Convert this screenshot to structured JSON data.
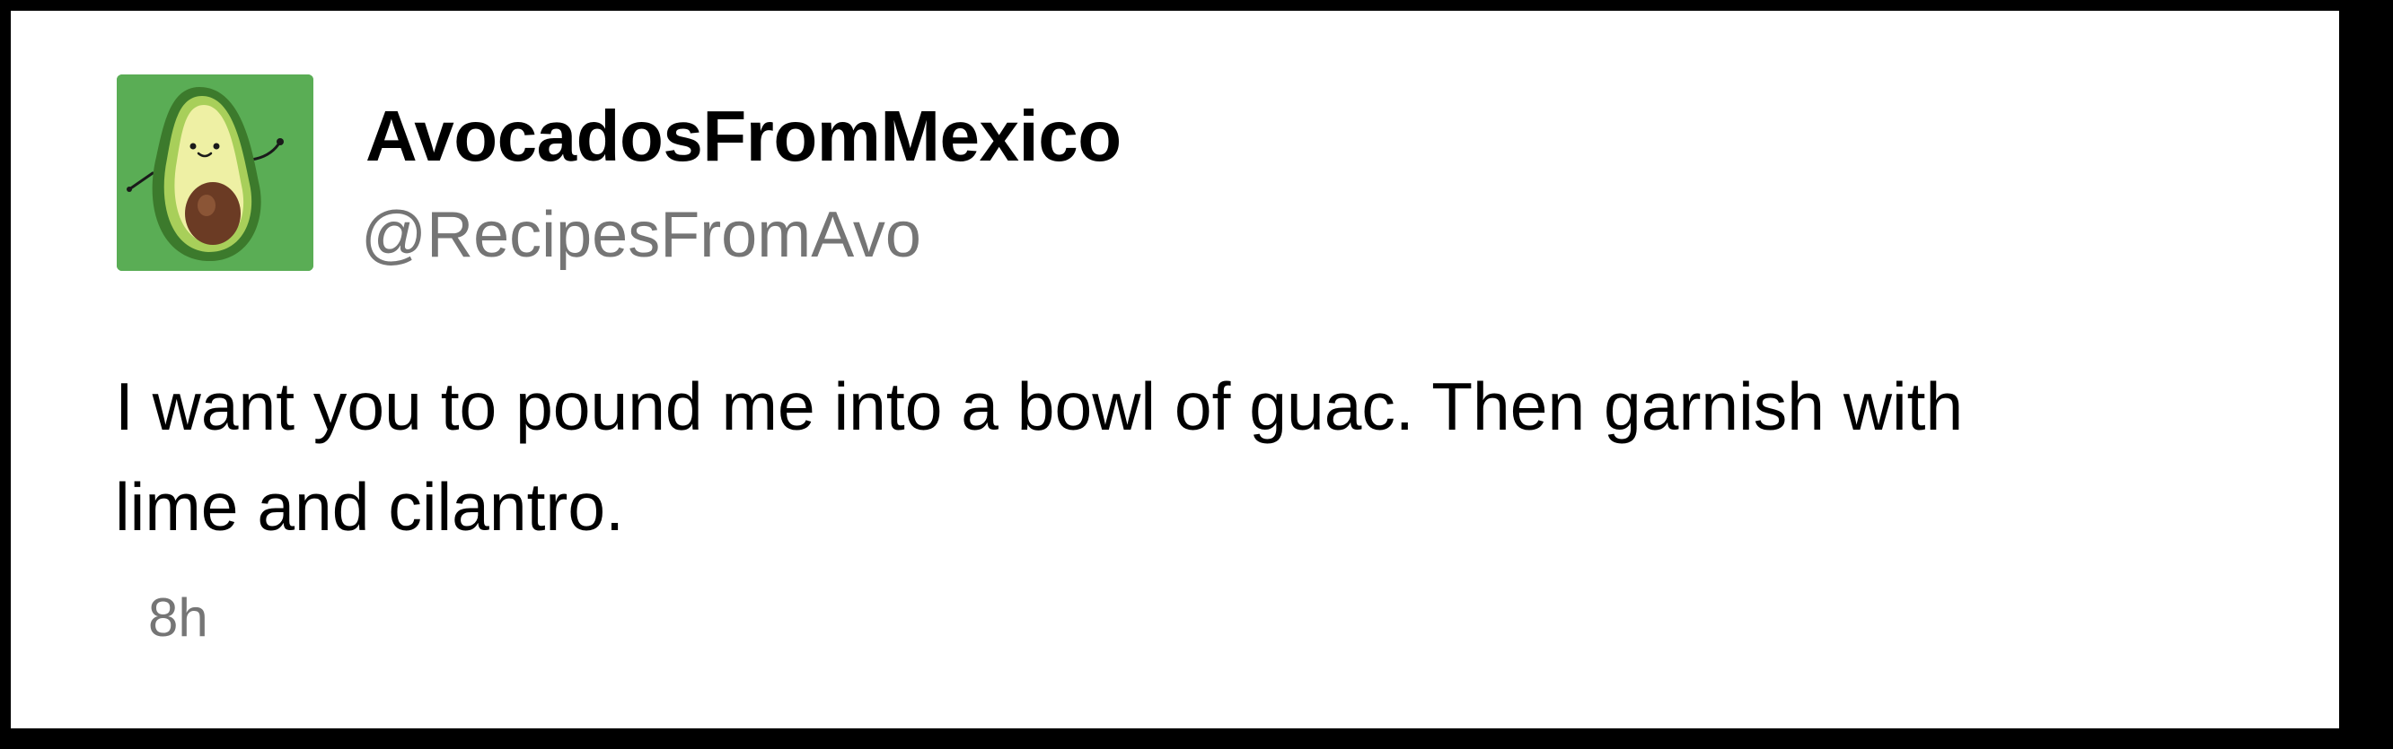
{
  "tweet": {
    "display_name": "AvocadosFromMexico",
    "handle": "@RecipesFromAvo",
    "text": "I want you to pound me into a bowl of guac. Then garnish with lime and cilantro.",
    "timestamp": "8h"
  },
  "avatar": {
    "icon": "avocado-icon",
    "background_color": "#5aad55"
  }
}
